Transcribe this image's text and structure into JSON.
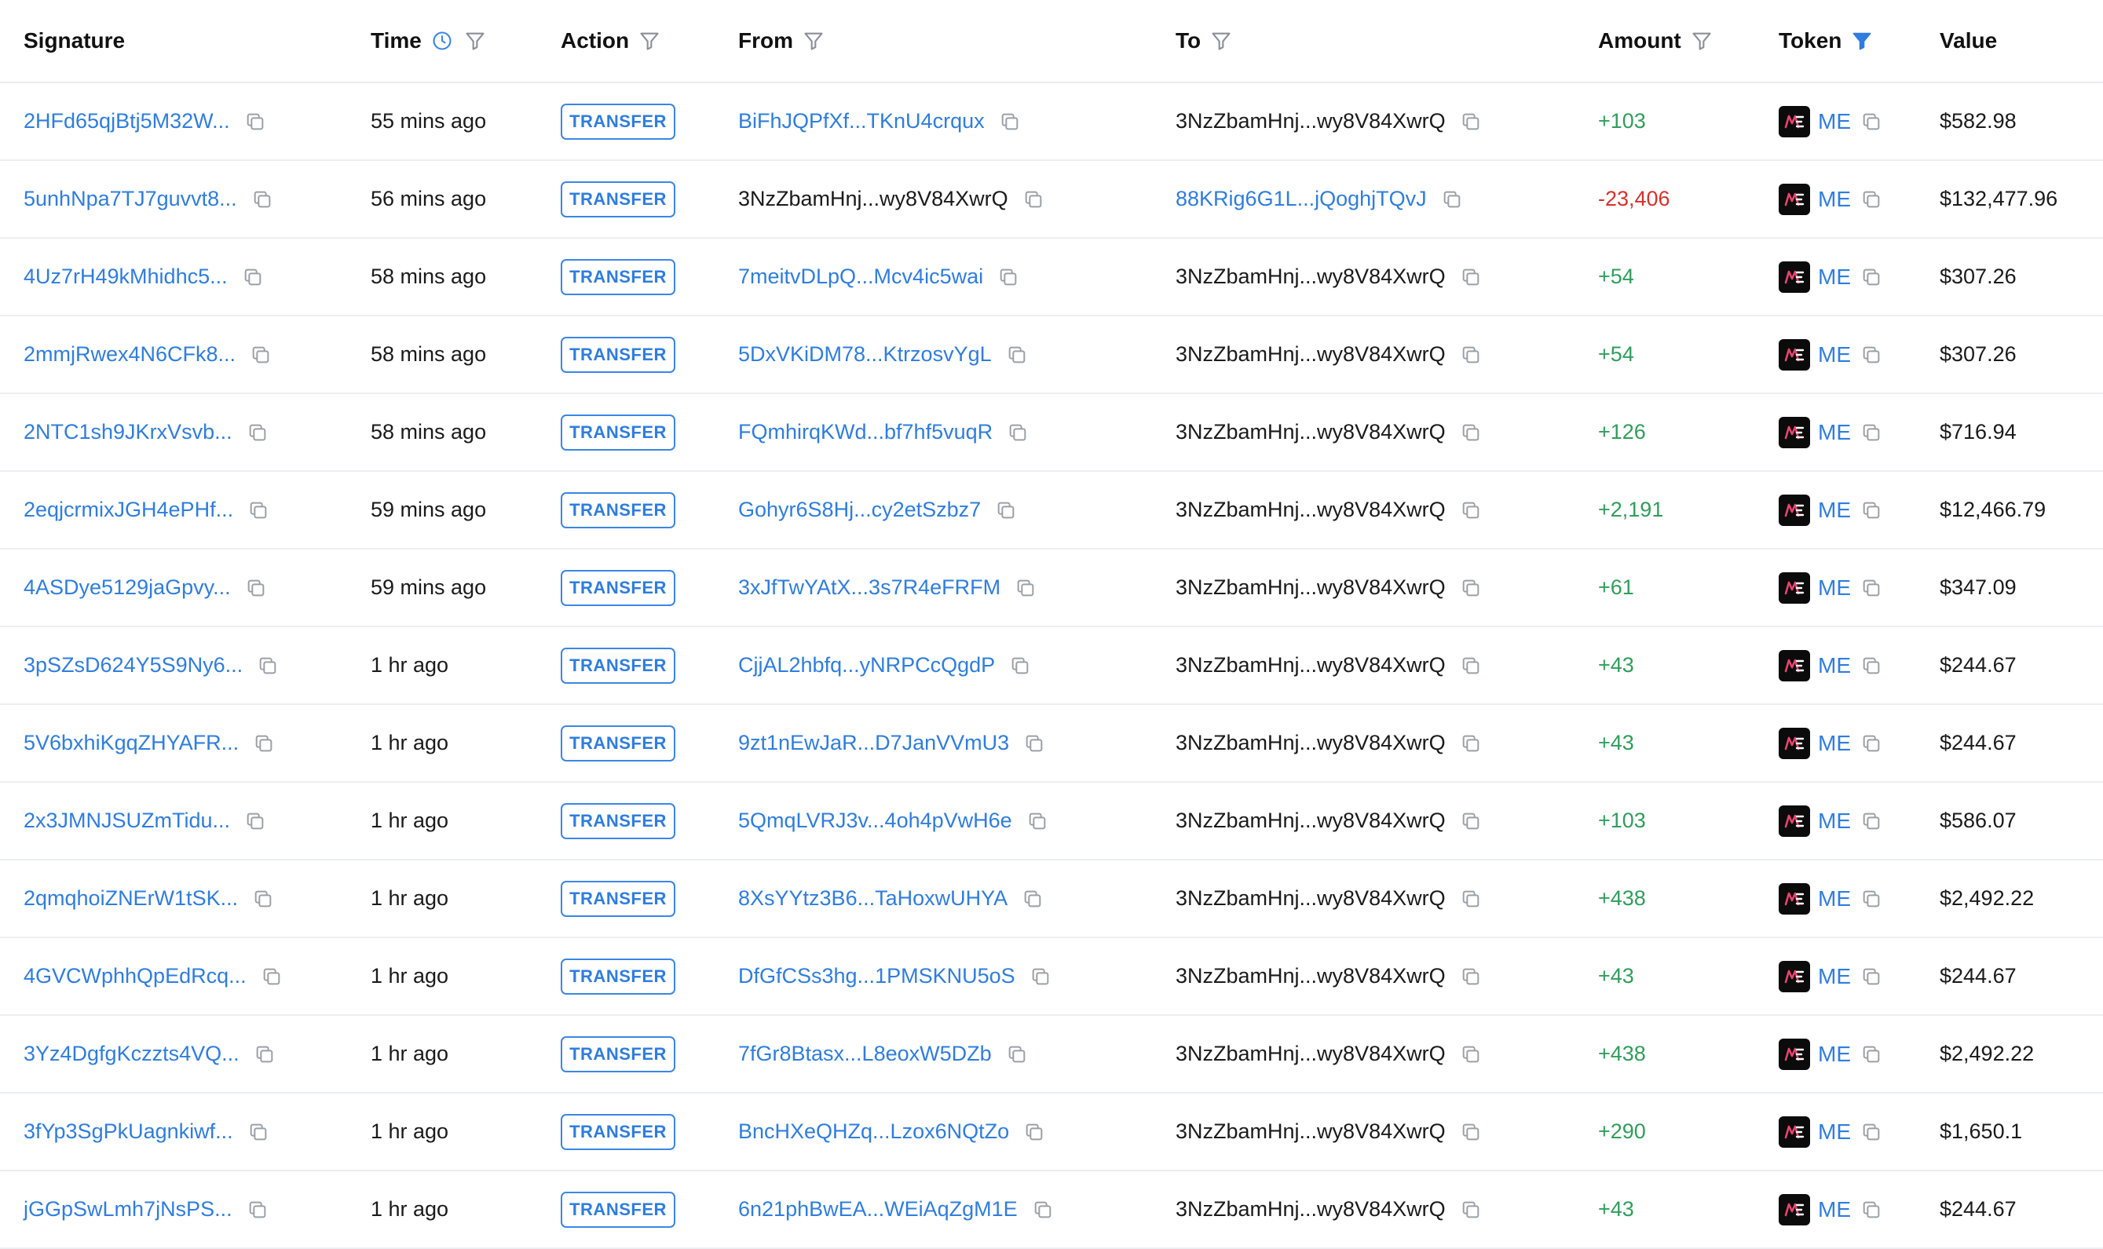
{
  "colors": {
    "link": "#2e7de0",
    "positive": "#2f9e5b",
    "negative": "#d9302c",
    "badge_border": "#3b86e6",
    "row_divider": "#eceef1"
  },
  "header": {
    "signature": "Signature",
    "time": "Time",
    "action": "Action",
    "from": "From",
    "to": "To",
    "amount": "Amount",
    "token": "Token",
    "value": "Value",
    "icons": {
      "time_clock": "clock-icon",
      "filter": "filter-icon",
      "token_filter_active": "filter-icon-active"
    }
  },
  "rows": [
    {
      "signature": "2HFd65qjBtj5M32W...",
      "time": "55 mins ago",
      "action": "TRANSFER",
      "from": "BiFhJQPfXf...TKnU4crqux",
      "from_link": true,
      "to": "3NzZbamHnj...wy8V84XwrQ",
      "to_link": false,
      "amount": "+103",
      "amount_sign": "pos",
      "token": "ME",
      "value": "$582.98"
    },
    {
      "signature": "5unhNpa7TJ7guvvt8...",
      "time": "56 mins ago",
      "action": "TRANSFER",
      "from": "3NzZbamHnj...wy8V84XwrQ",
      "from_link": false,
      "to": "88KRig6G1L...jQoghjTQvJ",
      "to_link": true,
      "amount": "-23,406",
      "amount_sign": "neg",
      "token": "ME",
      "value": "$132,477.96"
    },
    {
      "signature": "4Uz7rH49kMhidhc5...",
      "time": "58 mins ago",
      "action": "TRANSFER",
      "from": "7meitvDLpQ...Mcv4ic5wai",
      "from_link": true,
      "to": "3NzZbamHnj...wy8V84XwrQ",
      "to_link": false,
      "amount": "+54",
      "amount_sign": "pos",
      "token": "ME",
      "value": "$307.26"
    },
    {
      "signature": "2mmjRwex4N6CFk8...",
      "time": "58 mins ago",
      "action": "TRANSFER",
      "from": "5DxVKiDM78...KtrzosvYgL",
      "from_link": true,
      "to": "3NzZbamHnj...wy8V84XwrQ",
      "to_link": false,
      "amount": "+54",
      "amount_sign": "pos",
      "token": "ME",
      "value": "$307.26"
    },
    {
      "signature": "2NTC1sh9JKrxVsvb...",
      "time": "58 mins ago",
      "action": "TRANSFER",
      "from": "FQmhirqKWd...bf7hf5vuqR",
      "from_link": true,
      "to": "3NzZbamHnj...wy8V84XwrQ",
      "to_link": false,
      "amount": "+126",
      "amount_sign": "pos",
      "token": "ME",
      "value": "$716.94"
    },
    {
      "signature": "2eqjcrmixJGH4ePHf...",
      "time": "59 mins ago",
      "action": "TRANSFER",
      "from": "Gohyr6S8Hj...cy2etSzbz7",
      "from_link": true,
      "to": "3NzZbamHnj...wy8V84XwrQ",
      "to_link": false,
      "amount": "+2,191",
      "amount_sign": "pos",
      "token": "ME",
      "value": "$12,466.79"
    },
    {
      "signature": "4ASDye5129jaGpvy...",
      "time": "59 mins ago",
      "action": "TRANSFER",
      "from": "3xJfTwYAtX...3s7R4eFRFM",
      "from_link": true,
      "to": "3NzZbamHnj...wy8V84XwrQ",
      "to_link": false,
      "amount": "+61",
      "amount_sign": "pos",
      "token": "ME",
      "value": "$347.09"
    },
    {
      "signature": "3pSZsD624Y5S9Ny6...",
      "time": "1 hr ago",
      "action": "TRANSFER",
      "from": "CjjAL2hbfq...yNRPCcQgdP",
      "from_link": true,
      "to": "3NzZbamHnj...wy8V84XwrQ",
      "to_link": false,
      "amount": "+43",
      "amount_sign": "pos",
      "token": "ME",
      "value": "$244.67"
    },
    {
      "signature": "5V6bxhiKgqZHYAFR...",
      "time": "1 hr ago",
      "action": "TRANSFER",
      "from": "9zt1nEwJaR...D7JanVVmU3",
      "from_link": true,
      "to": "3NzZbamHnj...wy8V84XwrQ",
      "to_link": false,
      "amount": "+43",
      "amount_sign": "pos",
      "token": "ME",
      "value": "$244.67"
    },
    {
      "signature": "2x3JMNJSUZmTidu...",
      "time": "1 hr ago",
      "action": "TRANSFER",
      "from": "5QmqLVRJ3v...4oh4pVwH6e",
      "from_link": true,
      "to": "3NzZbamHnj...wy8V84XwrQ",
      "to_link": false,
      "amount": "+103",
      "amount_sign": "pos",
      "token": "ME",
      "value": "$586.07"
    },
    {
      "signature": "2qmqhoiZNErW1tSK...",
      "time": "1 hr ago",
      "action": "TRANSFER",
      "from": "8XsYYtz3B6...TaHoxwUHYA",
      "from_link": true,
      "to": "3NzZbamHnj...wy8V84XwrQ",
      "to_link": false,
      "amount": "+438",
      "amount_sign": "pos",
      "token": "ME",
      "value": "$2,492.22"
    },
    {
      "signature": "4GVCWphhQpEdRcq...",
      "time": "1 hr ago",
      "action": "TRANSFER",
      "from": "DfGfCSs3hg...1PMSKNU5oS",
      "from_link": true,
      "to": "3NzZbamHnj...wy8V84XwrQ",
      "to_link": false,
      "amount": "+43",
      "amount_sign": "pos",
      "token": "ME",
      "value": "$244.67"
    },
    {
      "signature": "3Yz4DgfgKczzts4VQ...",
      "time": "1 hr ago",
      "action": "TRANSFER",
      "from": "7fGr8Btasx...L8eoxW5DZb",
      "from_link": true,
      "to": "3NzZbamHnj...wy8V84XwrQ",
      "to_link": false,
      "amount": "+438",
      "amount_sign": "pos",
      "token": "ME",
      "value": "$2,492.22"
    },
    {
      "signature": "3fYp3SgPkUagnkiwf...",
      "time": "1 hr ago",
      "action": "TRANSFER",
      "from": "BncHXeQHZq...Lzox6NQtZo",
      "from_link": true,
      "to": "3NzZbamHnj...wy8V84XwrQ",
      "to_link": false,
      "amount": "+290",
      "amount_sign": "pos",
      "token": "ME",
      "value": "$1,650.1"
    },
    {
      "signature": "jGGpSwLmh7jNsPS...",
      "time": "1 hr ago",
      "action": "TRANSFER",
      "from": "6n21phBwEA...WEiAqZgM1E",
      "from_link": true,
      "to": "3NzZbamHnj...wy8V84XwrQ",
      "to_link": false,
      "amount": "+43",
      "amount_sign": "pos",
      "token": "ME",
      "value": "$244.67"
    }
  ]
}
